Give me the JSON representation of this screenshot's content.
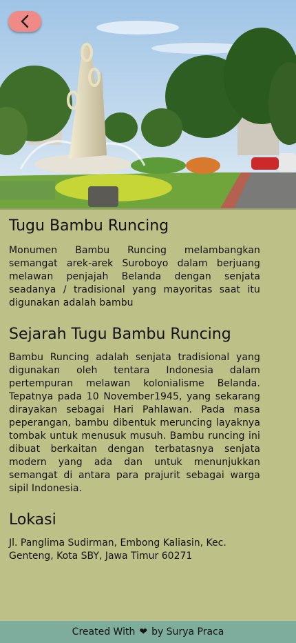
{
  "header": {
    "back_icon": "chevron-left-icon",
    "back_button_color": "#f08a86",
    "hero_image": "tugu-bambu-runcing-photo"
  },
  "main": {
    "title": "Tugu Bambu Runcing",
    "description": "Monumen Bambu Runcing melambangkan semangat arek-arek Suroboyo dalam berjuang melawan penjajah Belanda dengan senjata seadanya / tradisional yang mayoritas saat itu digunakan adalah bambu",
    "history_heading": "Sejarah Tugu Bambu Runcing",
    "history_text": "Bambu Runcing adalah senjata tradisional yang digunakan oleh tentara Indonesia dalam pertempuran melawan kolonialisme Belanda. Tepatnya pada 10 November1945, yang sekarang dirayakan sebagai Hari Pahlawan. Pada masa peperangan, bambu dibentuk meruncing layaknya tombak untuk menusuk musuh. Bambu runcing ini dibuat berkaitan dengan terbatasnya senjata modern yang ada dan untuk menunjukkan semangat di antara para prajurit sebagai warga sipil Indonesia.",
    "location_heading": "Lokasi",
    "location_text": "Jl. Panglima Sudirman, Embong Kaliasin, Kec. Genteng, Kota SBY, Jawa Timur 60271"
  },
  "footer": {
    "prefix": "Created With",
    "heart_icon": "heart-icon",
    "suffix": "by Surya Praca"
  },
  "colors": {
    "background": "#bec187",
    "footer": "#7fad9d"
  }
}
